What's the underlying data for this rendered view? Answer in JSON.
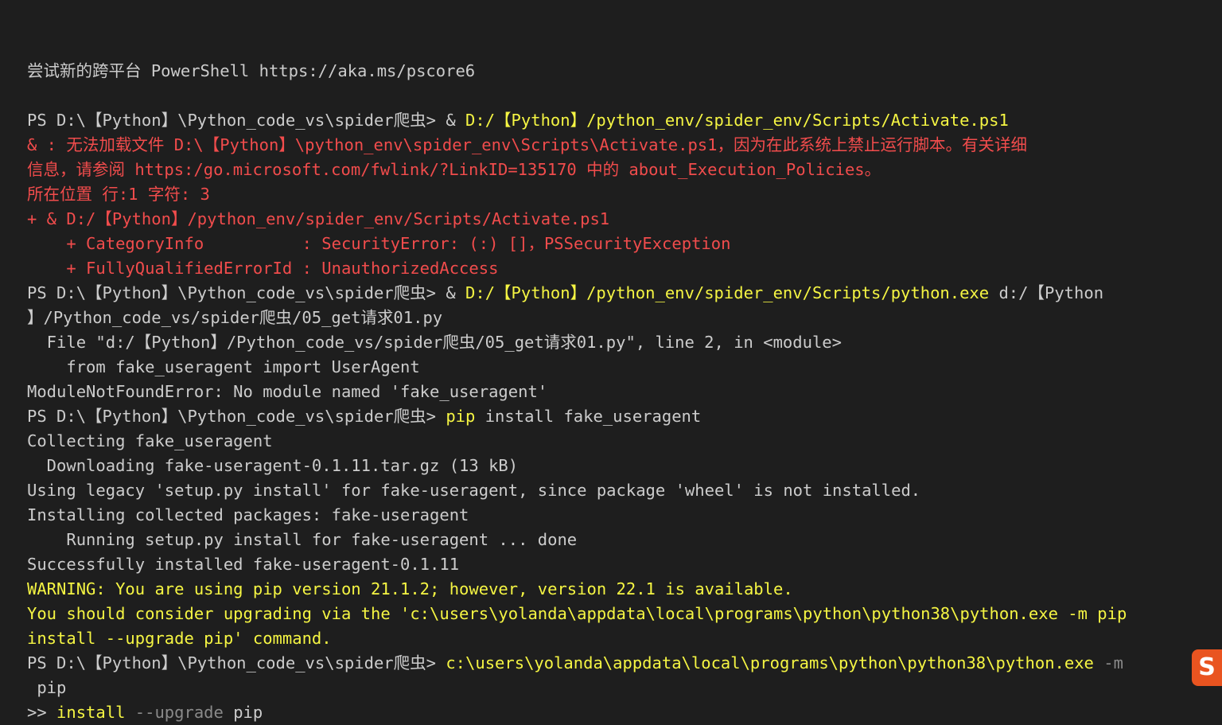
{
  "terminal": {
    "lines": [
      [
        {
          "t": "尝试新的跨平台 PowerShell https://aka.ms/pscore6",
          "c": "w"
        }
      ],
      [
        {
          "t": "",
          "c": "w"
        }
      ],
      [
        {
          "t": "PS D:\\【Python】\\Python_code_vs\\spider爬虫> ",
          "c": "w"
        },
        {
          "t": "& ",
          "c": "w"
        },
        {
          "t": "D:/【Python】/python_env/spider_env/Scripts/Activate.ps1",
          "c": "y"
        }
      ],
      [
        {
          "t": "& : 无法加载文件 D:\\【Python】\\python_env\\spider_env\\Scripts\\Activate.ps1，因为在此系统上禁止运行脚本。有关详细",
          "c": "r"
        }
      ],
      [
        {
          "t": "信息，请参阅 https:/go.microsoft.com/fwlink/?LinkID=135170 中的 about_Execution_Policies。",
          "c": "r"
        }
      ],
      [
        {
          "t": "所在位置 行:1 字符: 3",
          "c": "r"
        }
      ],
      [
        {
          "t": "+ & D:/【Python】/python_env/spider_env/Scripts/Activate.ps1",
          "c": "r"
        }
      ],
      [
        {
          "t": "    + CategoryInfo          : SecurityError: (:) []，PSSecurityException",
          "c": "r"
        }
      ],
      [
        {
          "t": "    + FullyQualifiedErrorId : UnauthorizedAccess",
          "c": "r"
        }
      ],
      [
        {
          "t": "PS D:\\【Python】\\Python_code_vs\\spider爬虫> ",
          "c": "w"
        },
        {
          "t": "& ",
          "c": "w"
        },
        {
          "t": "D:/【Python】/python_env/spider_env/Scripts/python.exe",
          "c": "y"
        },
        {
          "t": " d:/【Python",
          "c": "w"
        }
      ],
      [
        {
          "t": "】/Python_code_vs/spider爬虫/05_get请求01.py",
          "c": "w"
        }
      ],
      [
        {
          "t": "  File \"d:/【Python】/Python_code_vs/spider爬虫/05_get请求01.py\", line 2, in <module>",
          "c": "w"
        }
      ],
      [
        {
          "t": "    from fake_useragent import UserAgent",
          "c": "w"
        }
      ],
      [
        {
          "t": "ModuleNotFoundError: No module named 'fake_useragent'",
          "c": "w"
        }
      ],
      [
        {
          "t": "PS D:\\【Python】\\Python_code_vs\\spider爬虫> ",
          "c": "w"
        },
        {
          "t": "pip",
          "c": "y"
        },
        {
          "t": " install fake_useragent",
          "c": "w"
        }
      ],
      [
        {
          "t": "Collecting fake_useragent",
          "c": "w"
        }
      ],
      [
        {
          "t": "  Downloading fake-useragent-0.1.11.tar.gz (13 kB)",
          "c": "w"
        }
      ],
      [
        {
          "t": "Using legacy 'setup.py install' for fake-useragent, since package 'wheel' is not installed.",
          "c": "w"
        }
      ],
      [
        {
          "t": "Installing collected packages: fake-useragent",
          "c": "w"
        }
      ],
      [
        {
          "t": "    Running setup.py install for fake-useragent ... done",
          "c": "w"
        }
      ],
      [
        {
          "t": "Successfully installed fake-useragent-0.1.11",
          "c": "w"
        }
      ],
      [
        {
          "t": "WARNING: You are using pip version 21.1.2; however, version 22.1 is available.",
          "c": "y"
        }
      ],
      [
        {
          "t": "You should consider upgrading via the 'c:\\users\\yolanda\\appdata\\local\\programs\\python\\python38\\python.exe -m pip",
          "c": "y"
        }
      ],
      [
        {
          "t": "install --upgrade pip' command.",
          "c": "y"
        }
      ],
      [
        {
          "t": "PS D:\\【Python】\\Python_code_vs\\spider爬虫> ",
          "c": "w"
        },
        {
          "t": "c:\\users\\yolanda\\appdata\\local\\programs\\python\\python38\\python.exe",
          "c": "y"
        },
        {
          "t": " -m",
          "c": "g"
        }
      ],
      [
        {
          "t": " pip",
          "c": "w"
        }
      ],
      [
        {
          "t": ">> ",
          "c": "w"
        },
        {
          "t": "install",
          "c": "y"
        },
        {
          "t": " --upgrade",
          "c": "g"
        },
        {
          "t": " pip",
          "c": "w"
        }
      ]
    ]
  },
  "ime_logo": {
    "label": "S",
    "icon": "sogou-ime-icon"
  },
  "colors": {
    "background": "#1e1e1e",
    "text": "#cccccc",
    "command": "#f5f543",
    "error": "#f14c4c",
    "param": "#8a8a8a",
    "ime": "#e95420"
  }
}
